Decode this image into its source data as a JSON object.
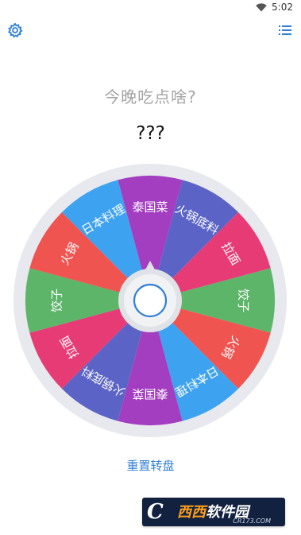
{
  "status_bar": {
    "time": "5:02",
    "wifi_icon": "wifi-icon"
  },
  "toolbar": {
    "settings_icon": "gear-icon",
    "list_icon": "list-icon",
    "accent": "#2f7ed8"
  },
  "prompt": "今晚吃点啥?",
  "result": "???",
  "wheel": {
    "segments": [
      {
        "label": "泰国菜",
        "color": "#a43ec1"
      },
      {
        "label": "火锅底料",
        "color": "#5b64c6"
      },
      {
        "label": "拉面",
        "color": "#e73b76"
      },
      {
        "label": "饺子",
        "color": "#5db56a"
      },
      {
        "label": "火锅",
        "color": "#ef5450"
      },
      {
        "label": "日本料理",
        "color": "#3da2f0"
      },
      {
        "label": "泰国菜",
        "color": "#a43ec1"
      },
      {
        "label": "火锅底料",
        "color": "#5b64c6"
      },
      {
        "label": "拉面",
        "color": "#e73b76"
      },
      {
        "label": "饺子",
        "color": "#5db56a"
      },
      {
        "label": "火锅",
        "color": "#ef5450"
      },
      {
        "label": "日本料理",
        "color": "#3da2f0"
      }
    ],
    "rim_color": "#e7e9ee",
    "hub_color": "#dfe2e7",
    "button_ring_color": "#2f7ed8"
  },
  "reset_label": "重置转盘",
  "watermark": {
    "letter": "C",
    "text_part1": "西西",
    "text_part2": "软件园",
    "sub": "CR173.COM"
  }
}
